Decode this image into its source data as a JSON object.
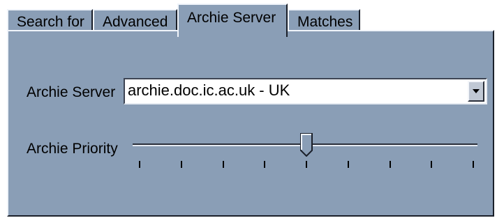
{
  "tabs": [
    {
      "label": "Search for",
      "active": false
    },
    {
      "label": "Advanced",
      "active": false
    },
    {
      "label": "Archie Server",
      "active": true
    },
    {
      "label": "Matches",
      "active": false
    }
  ],
  "server": {
    "label": "Archie Server",
    "selected": "archie.doc.ic.ac.uk - UK"
  },
  "priority": {
    "label": "Archie Priority",
    "value_fraction": 0.5,
    "tick_count": 9
  },
  "colors": {
    "panel": "#8a9eb6",
    "highlight": "#f0f4fa",
    "shadow": "#1a1f29"
  },
  "icons": {
    "dropdown": "chevron-down-icon"
  }
}
